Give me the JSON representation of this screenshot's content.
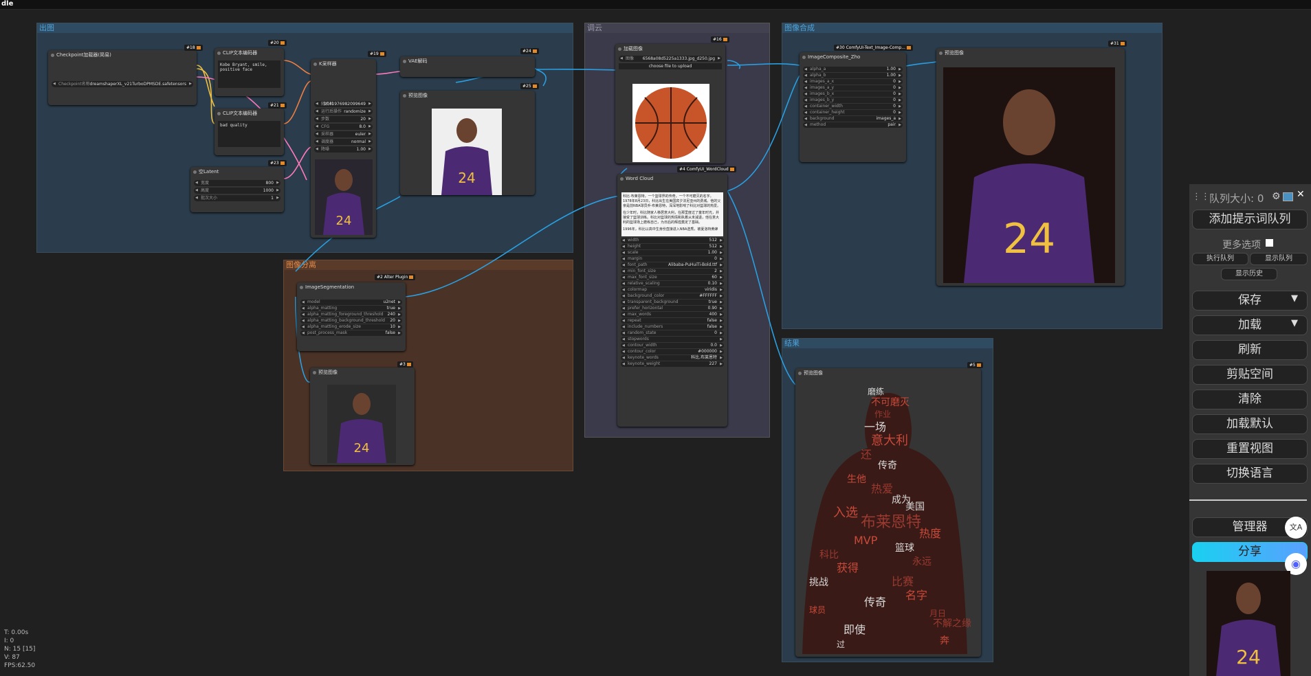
{
  "app": {
    "title": "dle"
  },
  "groups": {
    "chutu": "出图",
    "tiaoyun": "调云",
    "hecheng": "图像合成",
    "fenge": "图像分离",
    "jieguo": "结果"
  },
  "nodes": {
    "checkpoint": {
      "title": "Checkpoint加载器(简易)",
      "id": "#18",
      "label": "Checkpoint名称",
      "value": "dreamshaperXL_v21TurboDPMSDE.safetensors"
    },
    "clip_pos": {
      "title": "CLIP文本编码器",
      "id": "#20",
      "text": "Kobe Bryant, smile, positive face"
    },
    "clip_neg": {
      "title": "CLIP文本编码器",
      "id": "#21",
      "text": "bad quality"
    },
    "ksampler": {
      "title": "K采样器",
      "id": "#19",
      "widgets": [
        {
          "k": "随机种",
          "v": "1041976982099649"
        },
        {
          "k": "运行后操作",
          "v": "randomize"
        },
        {
          "k": "步数",
          "v": "20"
        },
        {
          "k": "CFG",
          "v": "8.0"
        },
        {
          "k": "采样器",
          "v": "euler"
        },
        {
          "k": "调度器",
          "v": "normal"
        },
        {
          "k": "降噪",
          "v": "1.00"
        }
      ]
    },
    "latent": {
      "title": "空Latent",
      "id": "#23",
      "widgets": [
        {
          "k": "宽度",
          "v": "800"
        },
        {
          "k": "高度",
          "v": "1000"
        },
        {
          "k": "批次大小",
          "v": "1"
        }
      ]
    },
    "vae": {
      "title": "VAE解码",
      "id": "#24"
    },
    "preview25": {
      "title": "预览图像",
      "id": "#25"
    },
    "loadimage": {
      "title": "加载图像",
      "id": "#16",
      "image_label": "图像",
      "image_value": "6568a08d5225a1333.jpg_d250.jpg",
      "upload": "choose file to upload"
    },
    "wordcloud": {
      "title": "Word Cloud",
      "id": "#4 ComfyUI_WordCloud",
      "text1": "科比·布莱恩特，一个篮球界的传奇，一个不可磨灭的名字。1978年8月23日，科比出生在美国宾夕法尼亚州的费城。他的父亲是前NBA球员乔·布莱恩特，深深地影响了科比对篮球的热爱。",
      "text2": "在少年时，科比随家人移居意大利，在那里度过了童年时光，并接受了篮球训练。科比对篮球的热情和执着从未减退，他在意大利的篮球场上磨练自己，为日后的辉煌奠定了基础。",
      "text3": "1996年，科比以高中生身份直接进入NBA选秀，被夏洛特黄蜂",
      "widgets": [
        {
          "k": "width",
          "v": "512"
        },
        {
          "k": "height",
          "v": "512"
        },
        {
          "k": "scale",
          "v": "1.00"
        },
        {
          "k": "margin",
          "v": "0"
        },
        {
          "k": "font_path",
          "v": "Alibaba-PuHuiTi-Bold.ttf"
        },
        {
          "k": "min_font_size",
          "v": "2"
        },
        {
          "k": "max_font_size",
          "v": "60"
        },
        {
          "k": "relative_scaling",
          "v": "0.10"
        },
        {
          "k": "colormap",
          "v": "viridis"
        },
        {
          "k": "background_color",
          "v": "#FFFFFF"
        },
        {
          "k": "transparent_background",
          "v": "true"
        },
        {
          "k": "prefer_horizontal",
          "v": "0.90"
        },
        {
          "k": "max_words",
          "v": "400"
        },
        {
          "k": "repeat",
          "v": "false"
        },
        {
          "k": "include_numbers",
          "v": "false"
        },
        {
          "k": "random_state",
          "v": "0"
        },
        {
          "k": "stopwords",
          "v": ""
        },
        {
          "k": "contour_width",
          "v": "0.0"
        },
        {
          "k": "contour_color",
          "v": "#000000"
        },
        {
          "k": "keynote_words",
          "v": "科比,布莱恩特"
        },
        {
          "k": "keynote_weight",
          "v": "227"
        }
      ]
    },
    "composite": {
      "title": "ImageComposite_Zho",
      "id": "#30 ComfyUI-Text_Image-Comp...",
      "widgets": [
        {
          "k": "alpha_a",
          "v": "1.00"
        },
        {
          "k": "alpha_b",
          "v": "1.00"
        },
        {
          "k": "images_a_x",
          "v": "0"
        },
        {
          "k": "images_a_y",
          "v": "0"
        },
        {
          "k": "images_b_x",
          "v": "0"
        },
        {
          "k": "images_b_y",
          "v": "0"
        },
        {
          "k": "container_width",
          "v": "0"
        },
        {
          "k": "container_height",
          "v": "0"
        },
        {
          "k": "background",
          "v": "images_a"
        },
        {
          "k": "method",
          "v": "pair"
        }
      ]
    },
    "preview31": {
      "title": "预览图像",
      "id": "#31"
    },
    "segmentation": {
      "title": "ImageSegmentation",
      "id": "#2 Alter Plugin",
      "widgets": [
        {
          "k": "model",
          "v": "u2net"
        },
        {
          "k": "alpha_matting",
          "v": "true"
        },
        {
          "k": "alpha_matting_foreground_threshold",
          "v": "240"
        },
        {
          "k": "alpha_matting_background_threshold",
          "v": "20"
        },
        {
          "k": "alpha_matting_erode_size",
          "v": "10"
        },
        {
          "k": "post_process_mask",
          "v": "false"
        }
      ]
    },
    "preview3": {
      "title": "预览图像",
      "id": "#3"
    },
    "preview5": {
      "title": "预览图像",
      "id": "#5"
    }
  },
  "sidebar": {
    "queue_size": "队列大小: 0",
    "add_queue": "添加提示词队列",
    "more_options": "更多选项",
    "exec_queue": "执行队列",
    "show_queue": "显示队列",
    "show_history": "显示历史",
    "save": "保存",
    "load": "加载",
    "refresh": "刷新",
    "clipspace": "剪贴空间",
    "clear": "清除",
    "load_default": "加载默认",
    "reset_view": "重置视图",
    "switch_lang": "切换语言",
    "manager": "管理器",
    "share": "分享"
  },
  "stats": {
    "t": "T: 0.00s",
    "i": "I: 0",
    "n": "N: 15 [15]",
    "v": "V: 87",
    "fps": "FPS:62.50"
  },
  "wordcloud_words": [
    "磨练",
    "不可磨灭",
    "作业",
    "一场",
    "意大利",
    "还",
    "传奇",
    "生他",
    "热爱",
    "成为",
    "入选",
    "布莱恩特",
    "美国",
    "MVP",
    "科比",
    "篮球",
    "获得",
    "永远",
    "挑战",
    "名字",
    "月日",
    "即使",
    "球员",
    "不解之缘",
    "过",
    "奔",
    "比赛",
    "传奇",
    "热度"
  ],
  "colors": {
    "accent": "#29b6f6",
    "group_blue": "#2b3d4d",
    "group_orange": "#4a3226",
    "group_purple": "#3a3a4a",
    "wire": "#2a9fe0"
  }
}
